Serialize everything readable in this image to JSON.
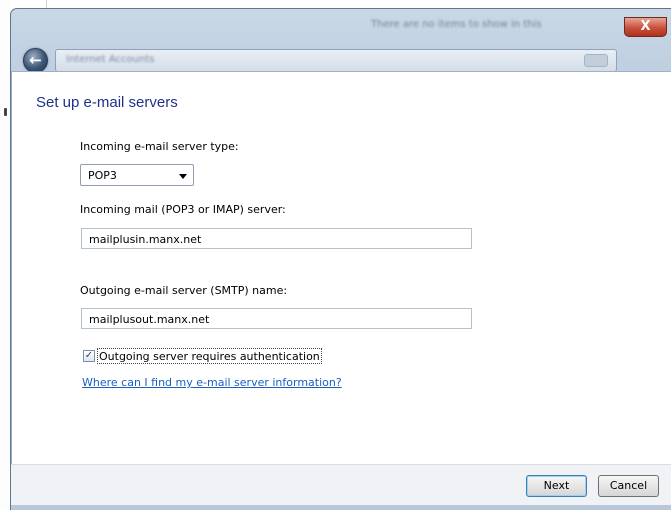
{
  "window": {
    "title": "There are no items to show in this view.",
    "address": "Internet Accounts",
    "close_glyph": "X",
    "back_glyph": "←"
  },
  "content": {
    "heading": "Set up e-mail servers",
    "incoming_type_label": "Incoming e-mail server type:",
    "incoming_type_value": "POP3",
    "incoming_server_label": "Incoming mail (POP3 or IMAP) server:",
    "incoming_server_value": "mailplusin.manx.net",
    "outgoing_server_label": "Outgoing e-mail server (SMTP) name:",
    "outgoing_server_value": "mailplusout.manx.net",
    "auth_checkbox_label": "Outgoing server requires authentication",
    "auth_checked": true,
    "help_link": "Where can I find my e-mail server information?"
  },
  "footer": {
    "next_label": "Next",
    "cancel_label": "Cancel"
  },
  "colors": {
    "heading": "#1e3287",
    "link": "#1a5fbf",
    "close_button": "#c9503b"
  }
}
